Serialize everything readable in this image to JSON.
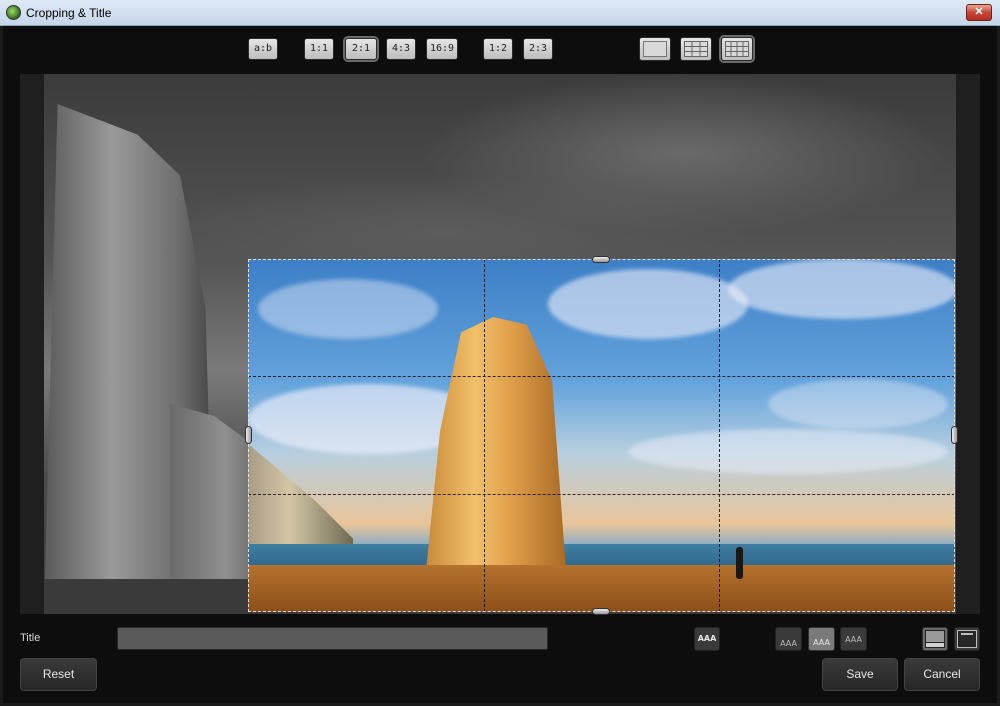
{
  "window": {
    "title": "Cropping & Title",
    "close_glyph": "✕"
  },
  "toolbar": {
    "ratios": [
      {
        "label": "a:b"
      },
      {
        "label": "1:1"
      },
      {
        "label": "2:1",
        "active": true
      },
      {
        "label": "4:3"
      },
      {
        "label": "16:9"
      },
      {
        "label": "1:2"
      },
      {
        "label": "2:3"
      }
    ],
    "grid_options": [
      "no-grid-icon",
      "grid-3x3-icon",
      "grid-4x3-icon"
    ]
  },
  "title_field": {
    "label": "Title",
    "value": "",
    "placeholder": ""
  },
  "text_style": {
    "glyph": "AAA"
  },
  "buttons": {
    "reset": "Reset",
    "save": "Save",
    "cancel": "Cancel"
  },
  "colors": {
    "accent": "#5a5a5a",
    "background": "#0d0d0d"
  }
}
